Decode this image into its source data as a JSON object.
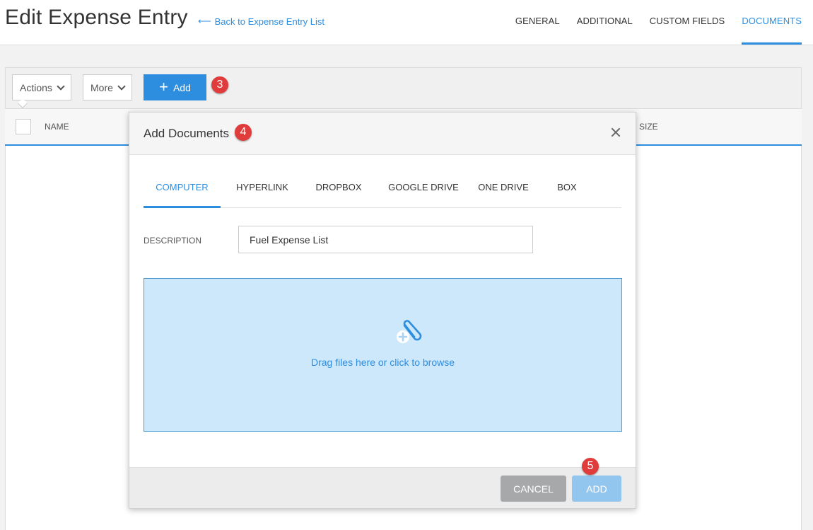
{
  "header": {
    "title": "Edit Expense Entry",
    "back_link": "Back to Expense Entry List",
    "tabs": [
      {
        "label": "GENERAL"
      },
      {
        "label": "ADDITIONAL"
      },
      {
        "label": "CUSTOM FIELDS"
      },
      {
        "label": "DOCUMENTS",
        "active": true
      }
    ]
  },
  "toolbar": {
    "actions_label": "Actions",
    "more_label": "More",
    "add_label": "Add"
  },
  "table": {
    "columns": [
      "NAME",
      "SIZE"
    ]
  },
  "badges": {
    "b3": "3",
    "b4": "4",
    "b5": "5"
  },
  "modal": {
    "title": "Add Documents",
    "source_tabs": [
      {
        "label": "COMPUTER",
        "active": true
      },
      {
        "label": "HYPERLINK"
      },
      {
        "label": "DROPBOX"
      },
      {
        "label": "GOOGLE DRIVE"
      },
      {
        "label": "ONE DRIVE"
      },
      {
        "label": "BOX"
      }
    ],
    "description_label": "DESCRIPTION",
    "description_value": "Fuel Expense List",
    "drop_text": "Drag files here or click to browse",
    "cancel_label": "CANCEL",
    "add_label": "ADD"
  },
  "colors": {
    "accent": "#2d8ee0",
    "badge": "#e03c3c",
    "dropzone_bg": "#cde7fb",
    "add_disabled": "#92c6ef",
    "cancel": "#a6a8aa"
  },
  "icons": {
    "back": "arrow-left-icon",
    "dropdown": "chevron-down-icon",
    "add": "plus-icon",
    "close": "close-icon",
    "attach": "paperclip-plus-icon"
  }
}
